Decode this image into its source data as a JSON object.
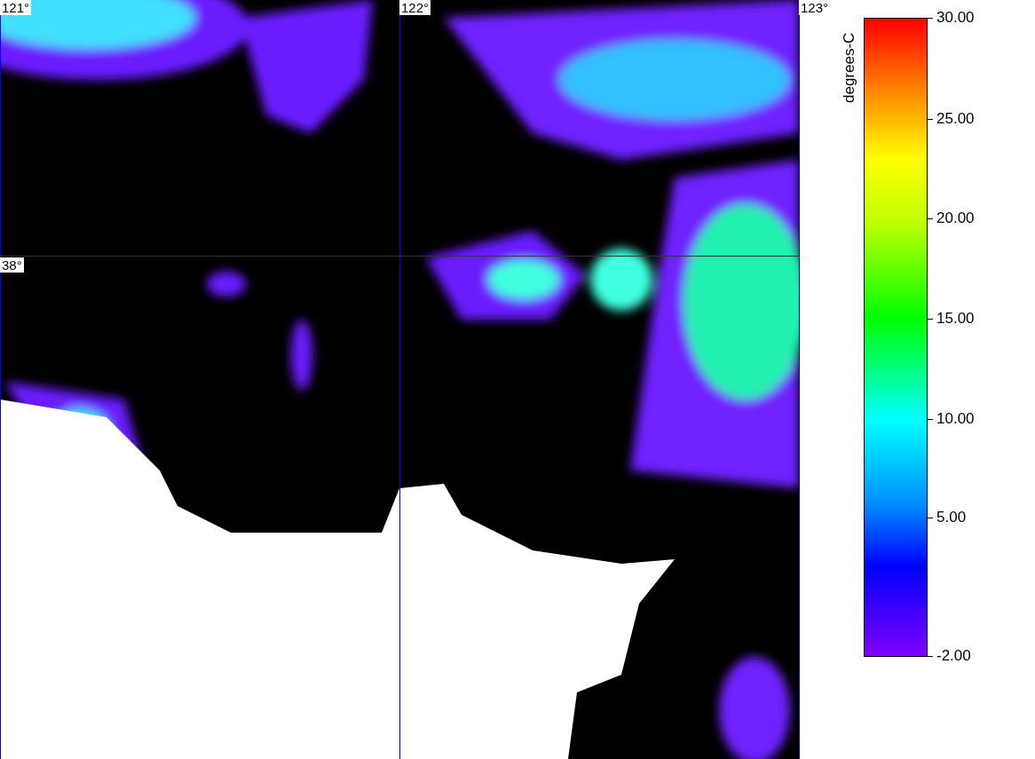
{
  "map": {
    "grid_labels": [
      {
        "label": "121°",
        "kind": "top"
      },
      {
        "label": "122°",
        "kind": "top"
      },
      {
        "label": "123°",
        "kind": "top"
      },
      {
        "label": "38°",
        "kind": "left"
      }
    ]
  },
  "legend": {
    "unit": "degrees-C",
    "ticks": [
      "30.00",
      "25.00",
      "20.00",
      "15.00",
      "10.00",
      "5.00",
      "-2.00"
    ]
  }
}
